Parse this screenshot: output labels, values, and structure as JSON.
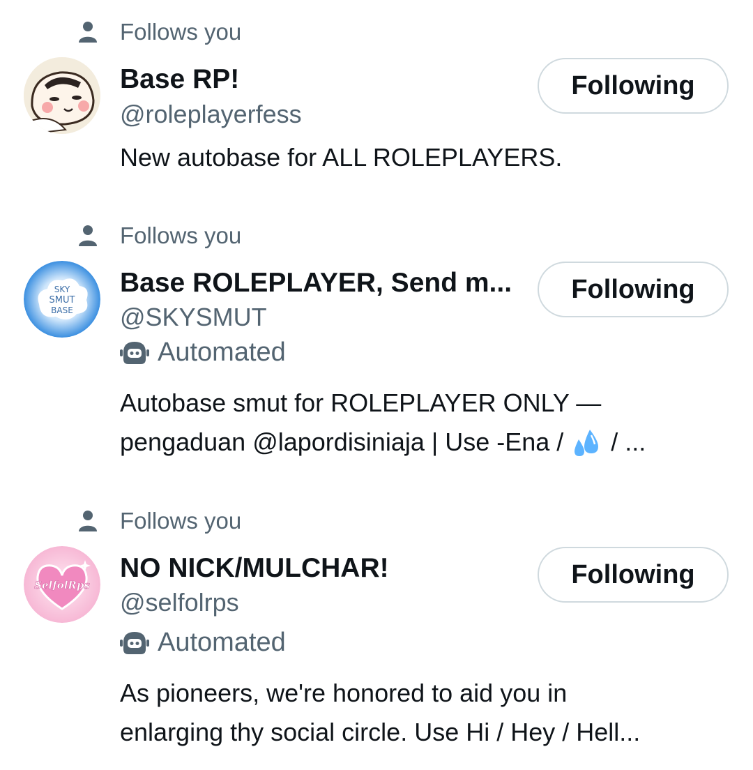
{
  "accounts": [
    {
      "follows_label": "Follows you",
      "name": "Base RP!",
      "handle": "@roleplayerfess",
      "bio_lines": [
        "New autobase for ALL ROLEPLAYERS."
      ],
      "button_label": "Following",
      "avatar_icon": "anime-character-avatar"
    },
    {
      "follows_label": "Follows you",
      "name": "Base ROLEPLAYER, Send m...",
      "handle": "@SKYSMUT",
      "automated_label": "Automated",
      "bio_lines": [
        "Autobase smut for ROLEPLAYER ONLY —",
        "pengaduan @lapordisiniaja | Use -Ena / ",
        " / ..."
      ],
      "button_label": "Following",
      "avatar_text": [
        "SKY",
        "SMUT",
        "BASE"
      ]
    },
    {
      "follows_label": "Follows you",
      "name": "NO NICK/MULCHAR!",
      "handle": "@selfolrps",
      "automated_label": "Automated",
      "bio_lines": [
        "As pioneers, we're honored to aid you in",
        "enlarging thy social circle. Use Hi / Hey / Hell..."
      ],
      "button_label": "Following",
      "avatar_text": [
        "SelfolRps"
      ]
    }
  ]
}
